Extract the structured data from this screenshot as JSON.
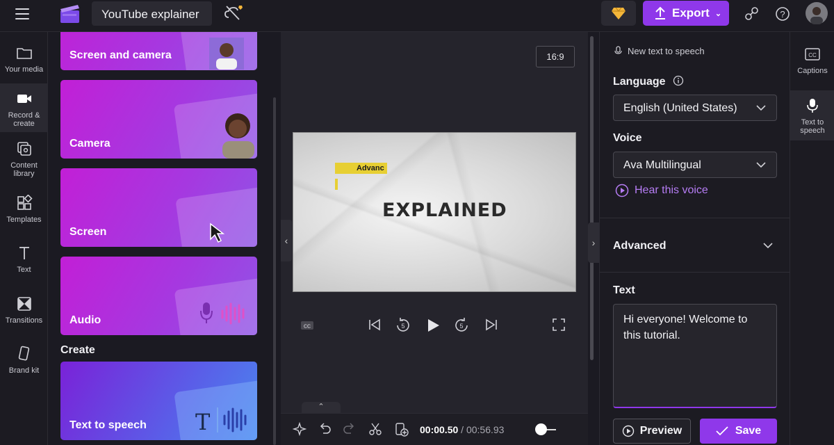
{
  "header": {
    "project_title": "YouTube explainer",
    "export_label": "Export"
  },
  "rail": {
    "items": [
      {
        "label": "Your media"
      },
      {
        "label": "Record & create"
      },
      {
        "label": "Content library"
      },
      {
        "label": "Templates"
      },
      {
        "label": "Text"
      },
      {
        "label": "Transitions"
      },
      {
        "label": "Brand kit"
      }
    ]
  },
  "panel": {
    "cards": [
      {
        "label": "Screen and camera"
      },
      {
        "label": "Camera"
      },
      {
        "label": "Screen"
      },
      {
        "label": "Audio"
      }
    ],
    "create_heading": "Create",
    "create_cards": [
      {
        "label": "Text to speech"
      }
    ]
  },
  "stage": {
    "aspect_ratio": "16:9",
    "video_tag_text": "Advanc",
    "video_title": "EXPLAINED",
    "time_current": "00:00.50",
    "time_separator": "/",
    "time_total": "00:56.93"
  },
  "props": {
    "header": "New text to speech",
    "language_label": "Language",
    "language_value": "English (United States)",
    "voice_label": "Voice",
    "voice_value": "Ava Multilingual",
    "hear_label": "Hear this voice",
    "advanced_label": "Advanced",
    "text_label": "Text",
    "text_value": "Hi everyone! Welcome to this tutorial.",
    "preview_label": "Preview",
    "save_label": "Save"
  },
  "right_rail": {
    "items": [
      {
        "label": "Captions"
      },
      {
        "label": "Text to speech"
      }
    ]
  },
  "colors": {
    "accent": "#8f38ea",
    "link": "#b67df5",
    "video_tag": "#e7cf33"
  }
}
